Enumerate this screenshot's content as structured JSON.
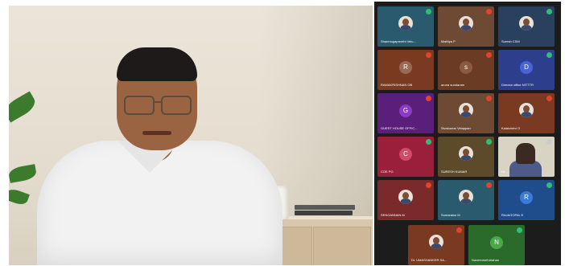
{
  "meeting": {
    "speaker": {
      "description_name": ""
    },
    "participants": [
      {
        "name": "Shanmugapreethi Velu...",
        "color": "#2a5a6e",
        "type": "avatar",
        "badge_color": "#2fbf71"
      },
      {
        "name": "Mathiya P",
        "color": "#6e4a35",
        "type": "avatar",
        "badge_color": "#e0442a"
      },
      {
        "name": "Suresh CSM",
        "color": "#29415e",
        "type": "avatar",
        "badge_color": "#2fbf71"
      },
      {
        "name": "RAMAKRISHNAN OB",
        "color": "#7a3a22",
        "type": "initial",
        "initial": "R",
        "initial_bg": "#9a6a55",
        "badge_color": "#e0442a"
      },
      {
        "name": "aruna sundaram",
        "color": "#6b3b24",
        "type": "initial",
        "initial": "s",
        "initial_bg": "#8c5a40",
        "badge_color": "#e0442a"
      },
      {
        "name": "Director office NITTTR",
        "color": "#2c3e8c",
        "type": "initial",
        "initial": "D",
        "initial_bg": "#4a64d8",
        "badge_color": "#2fbf71"
      },
      {
        "name": "GUEST HOUSE OFFIC...",
        "color": "#5a1f7a",
        "type": "initial",
        "initial": "G",
        "initial_bg": "#8a3cc4",
        "badge_color": "#e0442a"
      },
      {
        "name": "Sivakumar Velappan",
        "color": "#6e4a35",
        "type": "avatar",
        "badge_color": "#e0442a"
      },
      {
        "name": "Kalaichelvi G",
        "color": "#7a3a22",
        "type": "avatar",
        "badge_color": "#e0442a"
      },
      {
        "name": "COE PG",
        "color": "#9a1f3a",
        "type": "initial",
        "initial": "C",
        "initial_bg": "#d04a6a",
        "badge_color": "#2fbf71"
      },
      {
        "name": "SURESH KUMAR",
        "color": "#5c4a2a",
        "type": "avatar",
        "badge_color": "#2fbf71"
      },
      {
        "name": "Dr. ...",
        "color": "#d9d3c3",
        "type": "video",
        "badge_color": "#cccccc"
      },
      {
        "name": "SENGANNAN M",
        "color": "#7a2a2a",
        "type": "avatar",
        "badge_color": "#e0442a"
      },
      {
        "name": "Sumaraisn M",
        "color": "#2a5a6e",
        "type": "avatar",
        "badge_color": "#e0442a"
      },
      {
        "name": "RAJAGOPAL E",
        "color": "#1f4d8c",
        "type": "initial",
        "initial": "R",
        "initial_bg": "#3a7ad8",
        "badge_color": "#2fbf71"
      },
      {
        "name": "Dr. UMASHANKER SA...",
        "color": "#7a3a22",
        "type": "avatar",
        "badge_color": "#e0442a"
      },
      {
        "name": "Naveenmehdrahan",
        "color": "#2a6a2a",
        "type": "initial",
        "initial": "N",
        "initial_bg": "#4aa84a",
        "badge_color": "#2fbf71"
      }
    ]
  }
}
